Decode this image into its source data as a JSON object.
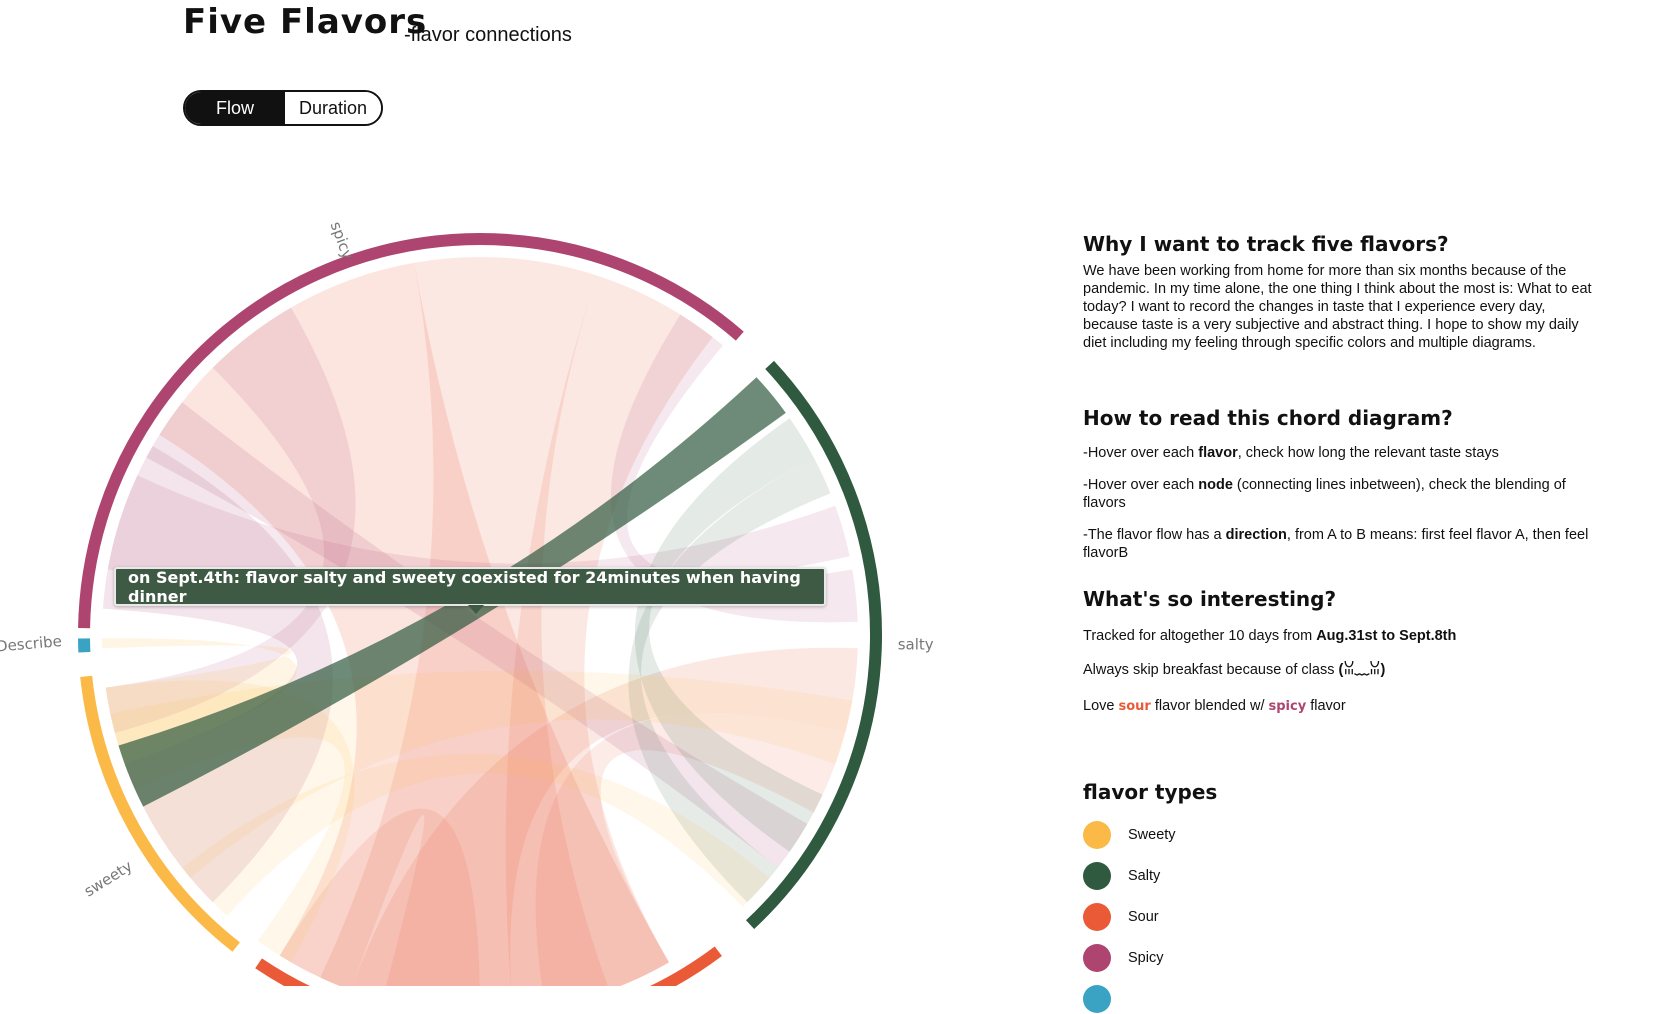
{
  "header": {
    "title": "Five Flavors",
    "subtitle": "-flavor connections"
  },
  "toggle": {
    "options": [
      "Flow",
      "Duration"
    ],
    "selected": "Flow"
  },
  "colors": {
    "Sweety": "#fbba48",
    "Salty": "#2f5a3f",
    "Sour": "#ea5a36",
    "Spicy": "#ad4570",
    "HardToDescribe": "#3aa3c4"
  },
  "chart_data": {
    "type": "chord",
    "groups": [
      {
        "name": "Spicy",
        "label": "spicy",
        "color": "#ad4570"
      },
      {
        "name": "Salty",
        "label": "salty",
        "color": "#2f5a3f"
      },
      {
        "name": "Sour",
        "label": "",
        "color": "#ea5a36"
      },
      {
        "name": "Sweety",
        "label": "sweety",
        "color": "#fbba48"
      },
      {
        "name": "HardToDescribe",
        "label": "hardToDescribe",
        "color": "#3aa3c4"
      }
    ],
    "highlighted": {
      "from": "Salty",
      "to": "Sweety"
    },
    "tooltip": "on Sept.4th: flavor salty and sweety coexisted for 24minutes when having dinner"
  },
  "info": {
    "why": {
      "heading": "Why I want to track five flavors?",
      "body": "We have been working from home for more than six months because of the pandemic. In my time alone, the one thing I think about the most is: What to eat today? I want to record the changes in taste that I experience every day, because taste is a very subjective and abstract thing. I hope to show my daily diet including my feeling through specific colors and multiple diagrams."
    },
    "how": {
      "heading": "How to read this chord diagram?",
      "items": [
        {
          "pre": "-Hover over each ",
          "bold": "flavor",
          "post": ", check how long the relevant taste stays"
        },
        {
          "pre": "-Hover over each ",
          "bold": "node",
          "post": " (connecting lines inbetween), check the blending of flavors"
        },
        {
          "pre": "-The flavor flow has a ",
          "bold": "direction",
          "post": ", from A to B means: first feel flavor A, then feel flavorB"
        }
      ]
    },
    "interesting": {
      "heading": "What's so interesting?",
      "line1_pre": "Tracked for altogether 10 days from ",
      "line1_bold": "Aug.31st to Sept.8th",
      "line2_pre": "Always skip breakfast because of class ",
      "line2_bold": "(ꈍ﹏ꈍ)",
      "line3_a": "Love ",
      "line3_sour": "sour",
      "line3_b": " flavor blended w/ ",
      "line3_spicy": "spicy",
      "line3_c": " flavor"
    },
    "legend": {
      "heading": "flavor types",
      "items": [
        {
          "label": "Sweety",
          "color": "#fbba48"
        },
        {
          "label": "Salty",
          "color": "#2f5a3f"
        },
        {
          "label": "Sour",
          "color": "#ea5a36"
        },
        {
          "label": "Spicy",
          "color": "#ad4570"
        },
        {
          "label": "",
          "color": "#3aa3c4"
        }
      ]
    }
  }
}
